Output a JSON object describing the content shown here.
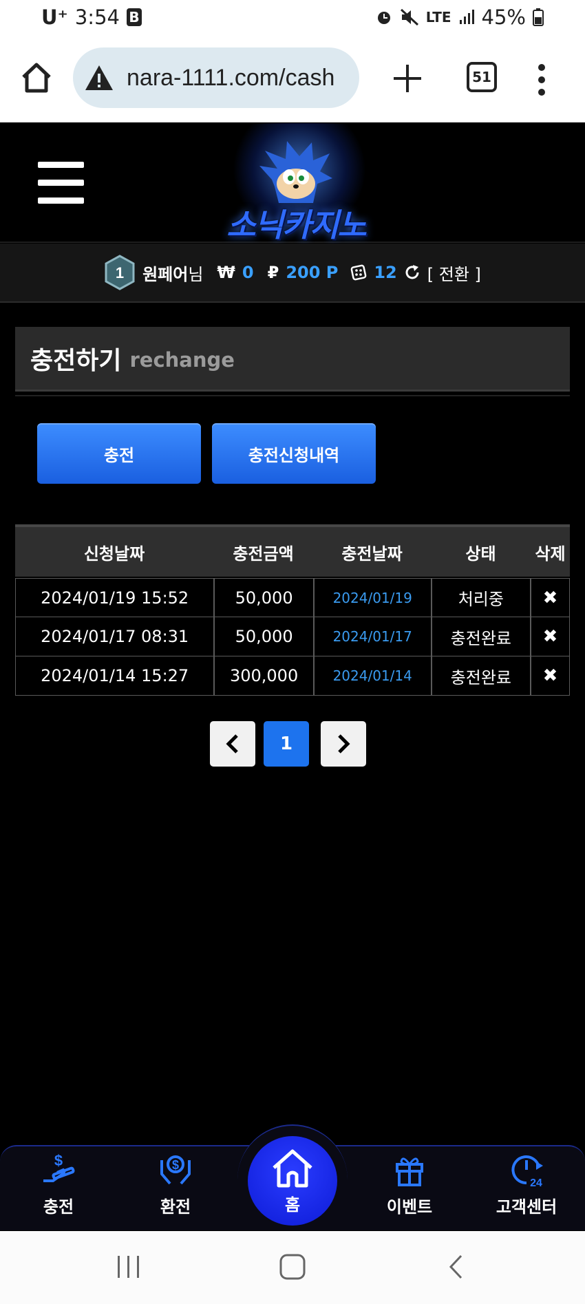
{
  "status_bar": {
    "carrier": "U⁺",
    "time": "3:54",
    "app_icon": "B",
    "network": "LTE",
    "battery": "45%"
  },
  "browser": {
    "url": "nara-1111.com/cash",
    "tab_count": "51"
  },
  "site": {
    "logo_text": "소닉카지노"
  },
  "user": {
    "level": "1",
    "name": "원페어",
    "suffix": "님",
    "won_symbol": "₩",
    "balance": "0",
    "point_symbol": "₽",
    "points": "200 P",
    "coupons": "12",
    "switch_label": "[ 전환 ]"
  },
  "page": {
    "title": "충전하기",
    "subtitle": "rechange"
  },
  "actions": {
    "charge": "충전",
    "history": "충전신청내역"
  },
  "table": {
    "headers": [
      "신청날짜",
      "충전금액",
      "충전날짜",
      "상태",
      "삭제"
    ],
    "rows": [
      {
        "requested": "2024/01/19 15:52",
        "amount": "50,000",
        "charged": "2024/01/19",
        "status": "처리중",
        "delete": "✖"
      },
      {
        "requested": "2024/01/17 08:31",
        "amount": "50,000",
        "charged": "2024/01/17",
        "status": "충전완료",
        "delete": "✖"
      },
      {
        "requested": "2024/01/14 15:27",
        "amount": "300,000",
        "charged": "2024/01/14",
        "status": "충전완료",
        "delete": "✖"
      }
    ]
  },
  "pagination": {
    "prev": "‹",
    "current": "1",
    "next": "›"
  },
  "bottom_nav": {
    "charge": "충전",
    "exchange": "환전",
    "home": "홈",
    "event": "이벤트",
    "support": "고객센터"
  },
  "colors": {
    "accent": "#1d73ee",
    "value_blue": "#3aa0ff",
    "nav_border": "#1b2a8c"
  }
}
